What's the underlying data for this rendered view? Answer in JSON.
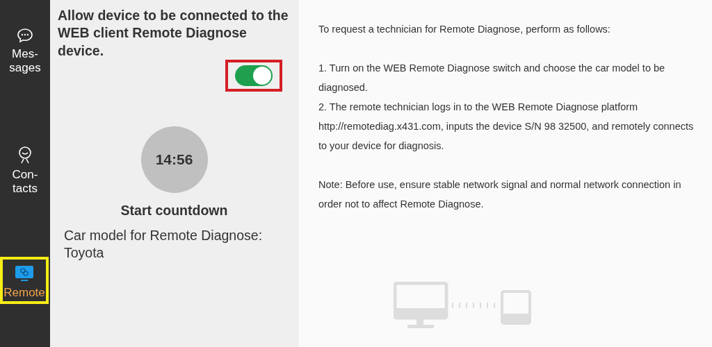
{
  "sidebar": {
    "items": [
      {
        "kind": "chat",
        "label": "Mes-\nsages",
        "selected": false
      },
      {
        "kind": "contact",
        "label": "Con-\ntacts",
        "selected": false
      },
      {
        "kind": "remote",
        "label": "Remote",
        "selected": true
      }
    ]
  },
  "settings": {
    "title": "Allow device to be connected to the WEB client Remote Diagnose device.",
    "switch_on": true,
    "timer": "14:56",
    "timer_label": "Start countdown",
    "car_model": "Car model for Remote Diagnose:\nToyota"
  },
  "instructions": {
    "paragraphs": [
      "To request a technician for Remote Diagnose, perform as follows:",
      " 1. Turn on the WEB Remote Diagnose switch and choose the car model to be diagnosed.\n 2. The remote technician logs in to the WEB Remote Diagnose platform http://remotediag.x431.com, inputs the device S/N 98 32500, and remotely connects to your device for diagnosis.",
      " Note: Before use, ensure stable network signal and normal network connection in order not to affect Remote Diagnose."
    ]
  }
}
